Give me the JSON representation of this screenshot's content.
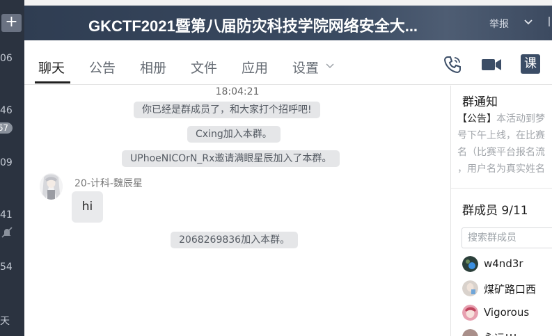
{
  "left_list": {
    "add_label": "+",
    "times": [
      "06",
      "46",
      "09",
      "41",
      "54",
      "天"
    ],
    "badge": "67"
  },
  "header": {
    "title": "GKCTF2021暨第八届防灾科技学院网络安全大...",
    "report_label": "举报"
  },
  "tabs": [
    "聊天",
    "公告",
    "相册",
    "文件",
    "应用",
    "设置"
  ],
  "toolbar": {
    "icons": [
      "phone-icon",
      "video-icon",
      "class-icon"
    ],
    "class_label": "课"
  },
  "chat": {
    "timestamp": "18:04:21",
    "system_messages": [
      "你已经是群成员了，和大家打个招呼吧!",
      "Cxing加入本群。",
      "UPhoeNICOrN_Rx邀请满眼星辰加入了本群。"
    ],
    "message": {
      "sender": "20-计科-魏辰星",
      "text": "hi"
    },
    "join_message": "2068269836加入本群。"
  },
  "panel": {
    "notice_title": "群通知",
    "notice_prefix": "【公告】",
    "notice_lines": [
      "本活动到梦",
      "号下午上线，在比赛",
      "名（比赛平台报名流",
      "，用户名为真实姓名"
    ],
    "members_title": "群成员 9/11",
    "search_placeholder": "搜索群成员",
    "members": [
      "w4nd3r",
      "煤矿路口西",
      "Vigorous",
      "永远!!!"
    ]
  },
  "colors": {
    "sidebar": "#2b3340",
    "header": "#34445a",
    "system_bubble": "#e5e6e8",
    "accent_phone": "#3b4d66"
  }
}
